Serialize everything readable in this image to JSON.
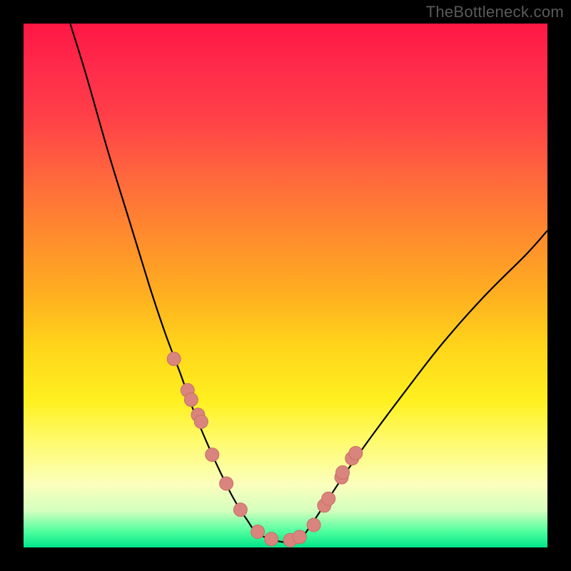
{
  "watermark": "TheBottleneck.com",
  "colors": {
    "curve_stroke": "#000000",
    "marker_fill": "#d9847c",
    "marker_stroke": "#c76f67",
    "frame": "#000000"
  },
  "chart_data": {
    "type": "line",
    "title": "",
    "xlabel": "",
    "ylabel": "",
    "xlim": [
      0,
      100
    ],
    "ylim": [
      0,
      100
    ],
    "grid": false,
    "legend": false,
    "note": "No axis labels or ticks are present in the image; values are pixel-space estimates mapped to a 0–100 range.",
    "series": [
      {
        "name": "main-curve",
        "x": [
          8.9,
          12.0,
          16.0,
          20.0,
          24.0,
          27.0,
          30.0,
          32.5,
          35.0,
          37.5,
          40.0,
          42.5,
          45.0,
          50.0,
          53.0,
          55.0,
          58.0,
          62.0,
          67.0,
          73.0,
          80.0,
          88.0,
          96.0,
          100.0
        ],
        "y": [
          100.0,
          90.0,
          76.0,
          63.0,
          50.0,
          41.0,
          33.0,
          26.0,
          20.0,
          14.5,
          9.5,
          5.5,
          2.5,
          1.0,
          2.0,
          4.5,
          9.0,
          15.0,
          22.0,
          30.0,
          39.0,
          48.0,
          56.0,
          60.5
        ]
      }
    ],
    "markers": {
      "name": "highlighted-points",
      "x": [
        28.7,
        31.3,
        32.0,
        33.3,
        33.9,
        36.0,
        38.7,
        41.4,
        44.7,
        47.3,
        50.9,
        52.7,
        55.4,
        57.4,
        58.2,
        60.7,
        60.9,
        62.7,
        63.4
      ],
      "y": [
        36.0,
        30.0,
        28.2,
        25.3,
        24.0,
        17.7,
        12.2,
        7.2,
        3.0,
        1.6,
        1.4,
        2.0,
        4.3,
        8.0,
        9.3,
        13.4,
        14.3,
        17.0,
        18.0
      ]
    }
  }
}
